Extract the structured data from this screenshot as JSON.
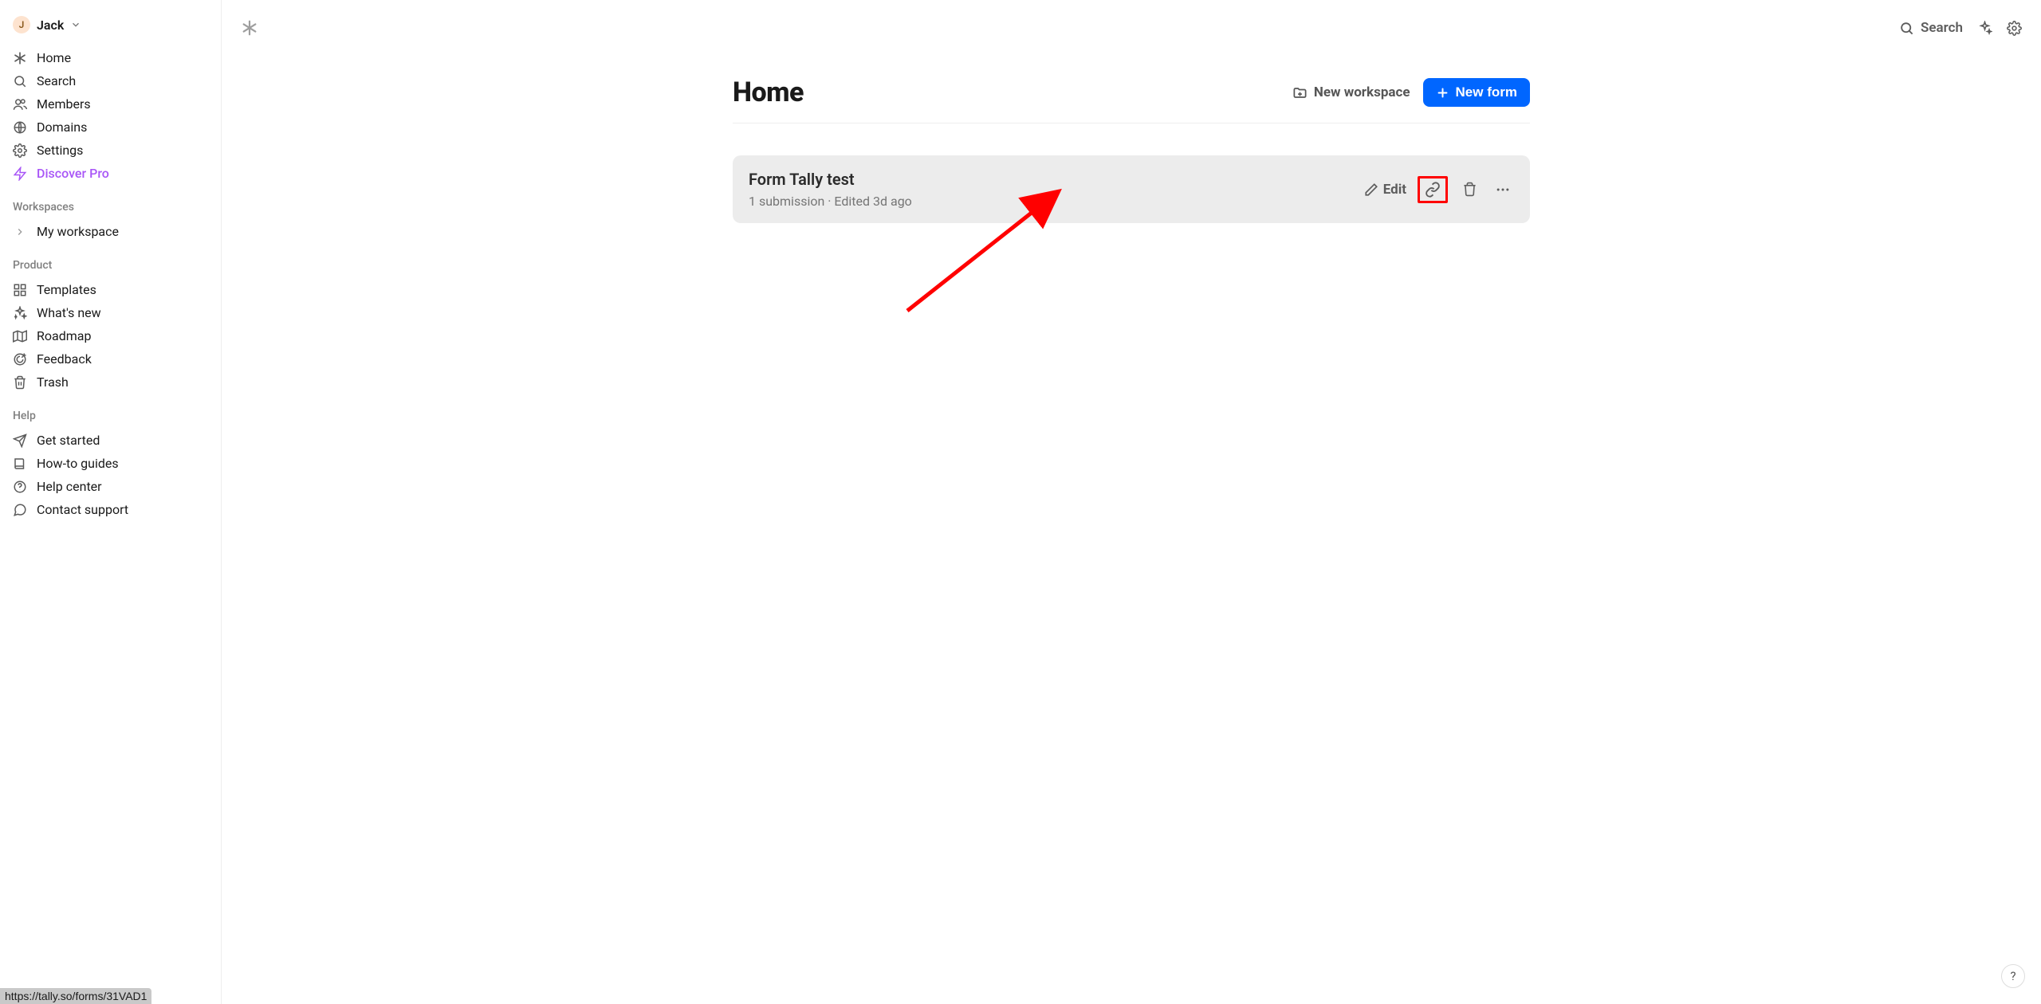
{
  "user": {
    "initial": "J",
    "name": "Jack"
  },
  "sidebar": {
    "main_items": [
      {
        "label": "Home"
      },
      {
        "label": "Search"
      },
      {
        "label": "Members"
      },
      {
        "label": "Domains"
      },
      {
        "label": "Settings"
      },
      {
        "label": "Discover Pro"
      }
    ],
    "workspaces_title": "Workspaces",
    "workspaces": [
      {
        "label": "My workspace"
      }
    ],
    "product_title": "Product",
    "product_items": [
      {
        "label": "Templates"
      },
      {
        "label": "What's new"
      },
      {
        "label": "Roadmap"
      },
      {
        "label": "Feedback"
      },
      {
        "label": "Trash"
      }
    ],
    "help_title": "Help",
    "help_items": [
      {
        "label": "Get started"
      },
      {
        "label": "How-to guides"
      },
      {
        "label": "Help center"
      },
      {
        "label": "Contact support"
      }
    ]
  },
  "topbar": {
    "search_label": "Search"
  },
  "page": {
    "title": "Home",
    "new_workspace": "New workspace",
    "new_form": "New form"
  },
  "form_card": {
    "title": "Form Tally test",
    "meta": "1 submission · Edited 3d ago",
    "edit_label": "Edit"
  },
  "help_fab": "?",
  "status_url": "https://tally.so/forms/31VAD1"
}
